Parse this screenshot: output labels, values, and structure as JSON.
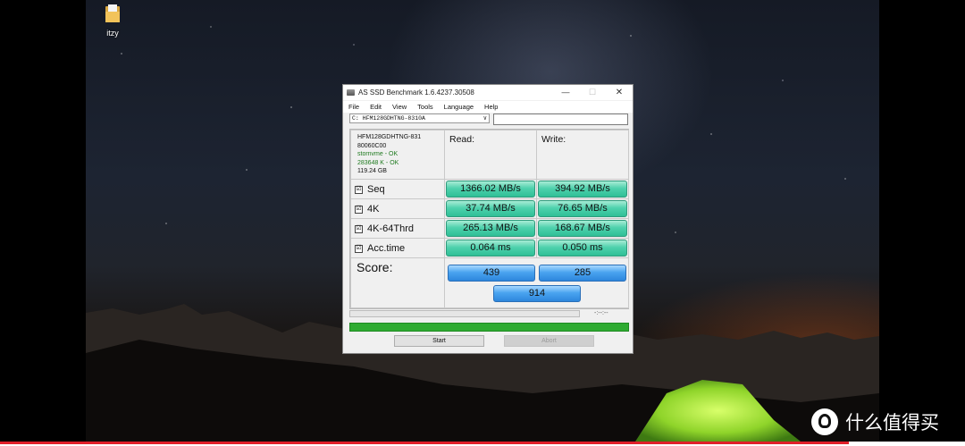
{
  "desktop": {
    "icon_label": "itzy"
  },
  "window": {
    "title": "AS SSD Benchmark 1.6.4237.30508",
    "controls": {
      "minimize": "—",
      "maximize": "☐",
      "close": "✕"
    },
    "menu": [
      "File",
      "Edit",
      "View",
      "Tools",
      "Language",
      "Help"
    ],
    "drive": {
      "selected": "C: HFM128GDHTNG-8310A",
      "path_value": ""
    },
    "info": {
      "model": "HFM128GDHTNG-831",
      "firmware": "80060C00",
      "driver": "stornvme - OK",
      "alignment": "283648 K - OK",
      "size": "119.24 GB"
    },
    "headers": {
      "read": "Read:",
      "write": "Write:"
    },
    "rows": [
      {
        "label": "Seq",
        "checked": "☑",
        "read": "1366.02 MB/s",
        "write": "394.92 MB/s"
      },
      {
        "label": "4K",
        "checked": "☑",
        "read": "37.74 MB/s",
        "write": "76.65 MB/s"
      },
      {
        "label": "4K-64Thrd",
        "checked": "☑",
        "read": "265.13 MB/s",
        "write": "168.67 MB/s"
      },
      {
        "label": "Acc.time",
        "checked": "☑",
        "read": "0.064 ms",
        "write": "0.050 ms"
      }
    ],
    "score": {
      "label": "Score:",
      "read": "439",
      "write": "285",
      "total": "914"
    },
    "timer": "-:--:--",
    "buttons": {
      "start": "Start",
      "abort": "Abort"
    },
    "colors": {
      "result_green": "#4fd1ad",
      "score_blue": "#4aa4f0",
      "progress_green": "#2fab32"
    }
  },
  "watermark": {
    "text": "什么值得买",
    "icon": "zdm-logo-icon"
  }
}
